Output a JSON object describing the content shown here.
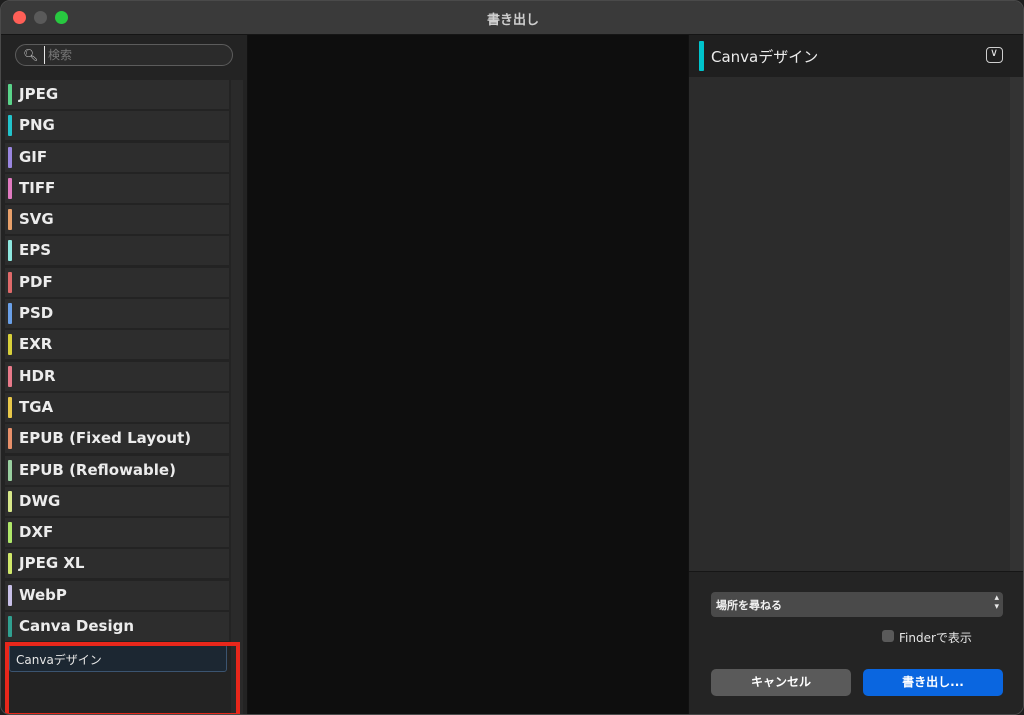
{
  "window": {
    "title": "書き出し"
  },
  "search": {
    "placeholder": "検索"
  },
  "formats": [
    {
      "label": "JPEG",
      "color": "#5ad48a"
    },
    {
      "label": "PNG",
      "color": "#22c4cc"
    },
    {
      "label": "GIF",
      "color": "#9a86e0"
    },
    {
      "label": "TIFF",
      "color": "#e07ac0"
    },
    {
      "label": "SVG",
      "color": "#e8a06a"
    },
    {
      "label": "EPS",
      "color": "#8ee8e0"
    },
    {
      "label": "PDF",
      "color": "#e06a6a"
    },
    {
      "label": "PSD",
      "color": "#6aa0e8"
    },
    {
      "label": "EXR",
      "color": "#d8d03a"
    },
    {
      "label": "HDR",
      "color": "#e87a8a"
    },
    {
      "label": "TGA",
      "color": "#e8c84a"
    },
    {
      "label": "EPUB (Fixed Layout)",
      "color": "#e8906a"
    },
    {
      "label": "EPUB (Reflowable)",
      "color": "#9ad0a0"
    },
    {
      "label": "DWG",
      "color": "#d8e88a"
    },
    {
      "label": "DXF",
      "color": "#b0e86a"
    },
    {
      "label": "JPEG XL",
      "color": "#d0e86a"
    },
    {
      "label": "WebP",
      "color": "#c8c0e8"
    },
    {
      "label": "Canva Design",
      "color": "#30a090"
    }
  ],
  "canva_subitem": {
    "label": "Canvaデザイン"
  },
  "panel": {
    "title": "Canvaデザイン",
    "accent_color": "#00c4cc",
    "location_select": "場所を尋ねる",
    "show_in_finder": "Finderで表示",
    "cancel_label": "キャンセル",
    "export_label": "書き出し..."
  }
}
